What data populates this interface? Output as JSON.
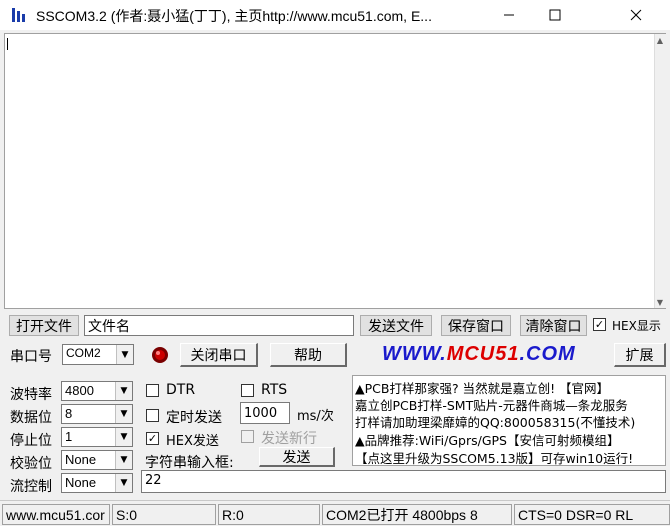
{
  "window": {
    "title": "SSCOM3.2 (作者:聂小猛(丁丁), 主页http://www.mcu51.com,  E...",
    "minimize_icon": "minimize-icon",
    "maximize_icon": "maximize-icon",
    "close_icon": "close-icon"
  },
  "file_row": {
    "open_file_label": "打开文件",
    "filename_value": "文件名",
    "send_file_label": "发送文件",
    "save_window_label": "保存窗口",
    "clear_window_label": "清除窗口",
    "hex_display_checked": true,
    "hex_display_label": "HEX显示"
  },
  "port_row": {
    "port_label": "串口号",
    "port_value": "COM2",
    "status_led_color": "#cc0000",
    "close_port_label": "关闭串口",
    "help_label": "帮助",
    "logo_part1": "WWW.",
    "logo_part2": "MCU51",
    "logo_part3": ".COM",
    "logo_color_blue": "#1a1acc",
    "logo_color_red": "#dd0000",
    "expand_label": "扩展"
  },
  "settings": {
    "baud_label": "波特率",
    "baud_value": "4800",
    "databits_label": "数据位",
    "databits_value": "8",
    "stopbits_label": "停止位",
    "stopbits_value": "1",
    "parity_label": "校验位",
    "parity_value": "None",
    "flow_label": "流控制",
    "flow_value": "None"
  },
  "send_opts": {
    "dtr_label": "DTR",
    "dtr_checked": false,
    "rts_label": "RTS",
    "rts_checked": false,
    "timed_send_label": "定时发送",
    "timed_send_checked": false,
    "interval_value": "1000",
    "interval_unit": "ms/次",
    "hex_send_label": "HEX发送",
    "hex_send_checked": true,
    "send_newline_label": "发送新行",
    "send_newline_checked": false,
    "string_input_label": "字符串输入框:",
    "send_label": "发送",
    "send_text_value": "22"
  },
  "ad_panel": {
    "lines": [
      "▲PCB打样那家强? 当然就是嘉立创! 【官网】",
      "嘉立创PCB打样-SMT贴片-元器件商城—条龙服务",
      "打样请加助理梁靡嫜的QQ:800058315(不懂技术)",
      "▲品牌推荐:WiFi/Gprs/GPS【安信可射频模组】",
      "【点这里升级为SSCOM5.13版】可存win10运行!"
    ]
  },
  "status_bar": {
    "website": "www.mcu51.cor",
    "sent": "S:0",
    "received": "R:0",
    "port_status": "COM2已打开  4800bps  8",
    "lines_status": "CTS=0 DSR=0 RL"
  }
}
